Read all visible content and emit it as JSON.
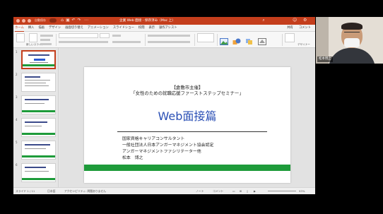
{
  "window": {
    "autosave_label": "自動保存",
    "doc_title": "企業 Web 面接 - 保存済み（Mac 上）"
  },
  "ribbon_tabs": [
    "ホーム",
    "挿入",
    "描画",
    "デザイン",
    "画面切り替え",
    "アニメーション",
    "スライドショー",
    "校閲",
    "表示",
    "操作アシスト"
  ],
  "ribbon_right": [
    "共有",
    "コメント"
  ],
  "ribbon": {
    "new_slide": "新しいスライド",
    "layout": "レイアウト",
    "reset": "リセット",
    "section": "セクション",
    "font_size": "18",
    "designer": "デザイナー"
  },
  "thumbnails": [
    {
      "num": "1"
    },
    {
      "num": "2"
    },
    {
      "num": "3"
    },
    {
      "num": "4"
    },
    {
      "num": "5"
    },
    {
      "num": "6"
    }
  ],
  "slide": {
    "organizer": "【倉敷市主催】",
    "event": "「女性のための就職応援ファーストステップセミナー」",
    "title": "Web面接篇",
    "lines": [
      "国家資格キャリアコンサルタント",
      "一般社団法人日本アンガーマネジメント協会認定",
      "アンガーマネジメントファシリテーター他",
      "松本　博之"
    ]
  },
  "status": {
    "slide_info": "スライド 1 / 11",
    "language": "日本語",
    "accessibility": "アクセシビリティ: 問題ありません",
    "notes": "ノート",
    "comments": "コメント",
    "zoom": "93%"
  },
  "video": {
    "participant_name": "松本博之"
  },
  "colors": {
    "accent": "#c43e1c",
    "slide_title": "#2a4fb5",
    "slide_band": "#1e9b3a"
  }
}
